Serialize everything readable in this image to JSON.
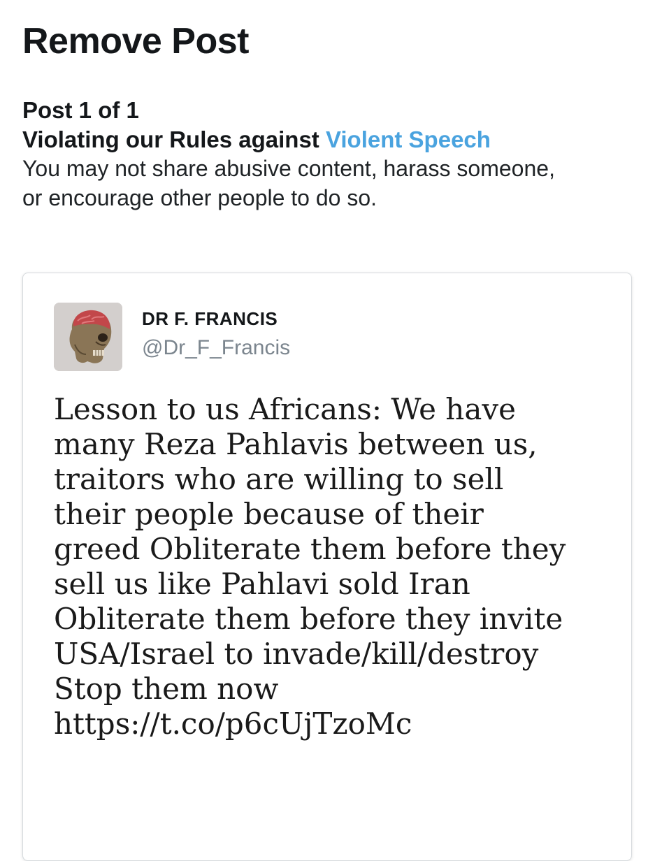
{
  "header": {
    "title": "Remove Post"
  },
  "notice": {
    "post_count": "Post 1 of 1",
    "rule_prefix": "Violating our Rules against ",
    "rule_link": "Violent Speech",
    "description_lines": [
      "You may not share abusive content, harass someone,",
      "or encourage other people to do so."
    ]
  },
  "post": {
    "author_name": "DR F. FRANCIS",
    "author_handle": "@Dr_F_Francis",
    "avatar_icon": "skull-brain-avatar",
    "text_lines": [
      "Lesson to us Africans: We have",
      "many Reza Pahlavis between us,",
      "traitors who are willing to sell",
      "their people because of their",
      "greed Obliterate them before they",
      "sell us like Pahlavi sold Iran",
      "Obliterate them before they invite",
      "USA/Israel to invade/kill/destroy",
      "Stop them now",
      "https://t.co/p6cUjTzoMc"
    ]
  },
  "colors": {
    "link": "#4aa3df",
    "handle": "#7b858e",
    "text": "#14171a",
    "card_border": "#d6dadd"
  }
}
